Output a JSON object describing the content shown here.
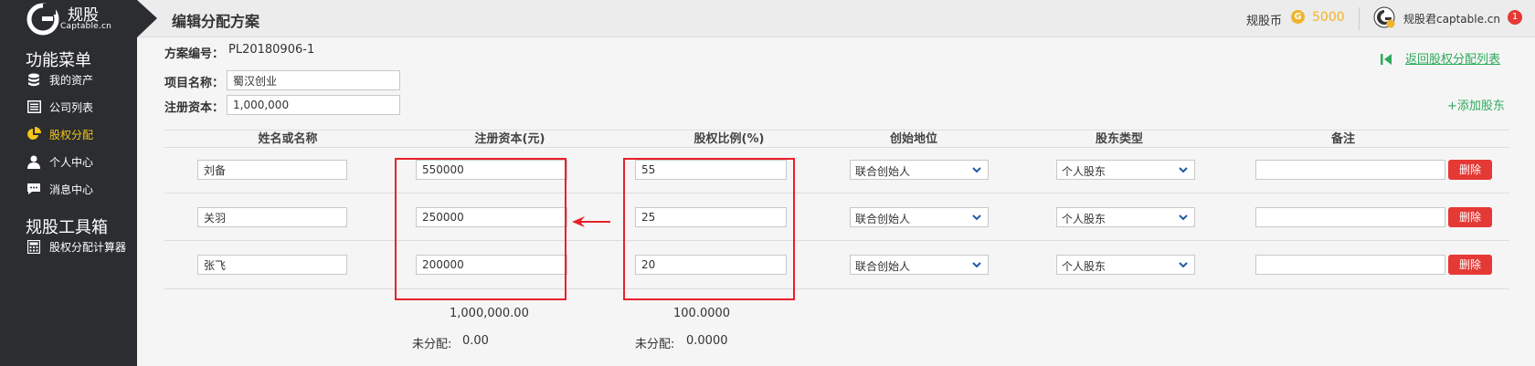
{
  "brand": {
    "name": "规股",
    "sub": "Captable.cn"
  },
  "sidebar": {
    "section1": "功能菜单",
    "items": [
      {
        "label": "我的资产",
        "icon": "database-icon"
      },
      {
        "label": "公司列表",
        "icon": "list-icon"
      },
      {
        "label": "股权分配",
        "icon": "pie-chart-icon",
        "active": true
      },
      {
        "label": "个人中心",
        "icon": "user-icon"
      },
      {
        "label": "消息中心",
        "icon": "message-icon"
      }
    ],
    "section2": "规股工具箱",
    "tools": [
      {
        "label": "股权分配计算器",
        "icon": "calculator-icon"
      }
    ]
  },
  "header": {
    "title": "编辑分配方案",
    "coin_label": "规股币",
    "coin_icon": "G",
    "coin_value": "5000",
    "user_name": "规股君captable.cn",
    "notification_count": "1"
  },
  "form": {
    "plan_no_label": "方案编号：",
    "plan_no": "PL20180906-1",
    "project_label": "项目名称：",
    "project_value": "蜀汉创业",
    "capital_label": "注册资本：",
    "capital_value": "1,000,000",
    "back_link": "返回股权分配列表",
    "add_shareholder": "+添加股东"
  },
  "table": {
    "headers": [
      "姓名或名称",
      "注册资本(元)",
      "股权比例(%)",
      "创始地位",
      "股东类型",
      "备注"
    ],
    "rows": [
      {
        "name": "刘备",
        "capital": "550000",
        "ratio": "55",
        "founder": "联合创始人",
        "type": "个人股东",
        "note": "",
        "delete": "删除"
      },
      {
        "name": "关羽",
        "capital": "250000",
        "ratio": "25",
        "founder": "联合创始人",
        "type": "个人股东",
        "note": "",
        "delete": "删除"
      },
      {
        "name": "张飞",
        "capital": "200000",
        "ratio": "20",
        "founder": "联合创始人",
        "type": "个人股东",
        "note": "",
        "delete": "删除"
      }
    ],
    "capital_total": "1,000,000.00",
    "ratio_total": "100.0000",
    "unallocated_label": "未分配:",
    "capital_unallocated": "0.00",
    "ratio_unallocated": "0.0000"
  },
  "colors": {
    "sidebar_bg": "#2b2d31",
    "active_item": "#f5c518",
    "accent_green": "#2eaa5c",
    "delete_red": "#e53935",
    "highlight_red": "#e8202a",
    "coin_gold": "#f0b429"
  }
}
